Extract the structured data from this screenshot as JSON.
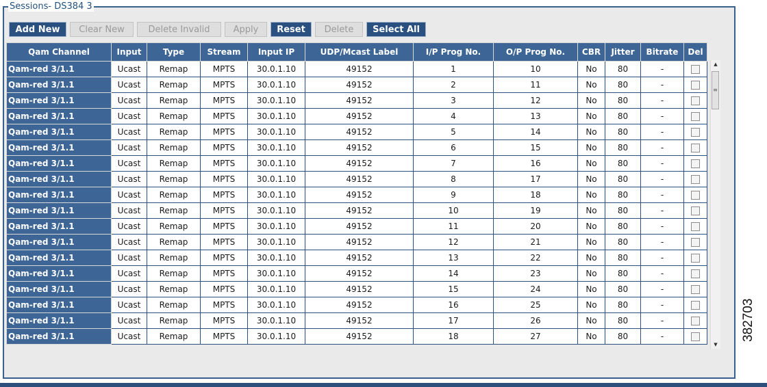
{
  "panel": {
    "title": "Sessions- DS384 3"
  },
  "toolbar": {
    "add_new": "Add New",
    "clear_new": "Clear New",
    "delete_invalid": "Delete Invalid",
    "apply": "Apply",
    "reset": "Reset",
    "delete": "Delete",
    "select_all": "Select All"
  },
  "columns": [
    "Qam Channel",
    "Input",
    "Type",
    "Stream",
    "Input IP",
    "UDP/Mcast Label",
    "I/P Prog No.",
    "O/P Prog No.",
    "CBR",
    "Jitter",
    "Bitrate",
    "Del"
  ],
  "rows": [
    [
      "Qam-red 3/1.1",
      "Ucast",
      "Remap",
      "MPTS",
      "30.0.1.10",
      "49152",
      "1",
      "10",
      "No",
      "80",
      "-"
    ],
    [
      "Qam-red 3/1.1",
      "Ucast",
      "Remap",
      "MPTS",
      "30.0.1.10",
      "49152",
      "2",
      "11",
      "No",
      "80",
      "-"
    ],
    [
      "Qam-red 3/1.1",
      "Ucast",
      "Remap",
      "MPTS",
      "30.0.1.10",
      "49152",
      "3",
      "12",
      "No",
      "80",
      "-"
    ],
    [
      "Qam-red 3/1.1",
      "Ucast",
      "Remap",
      "MPTS",
      "30.0.1.10",
      "49152",
      "4",
      "13",
      "No",
      "80",
      "-"
    ],
    [
      "Qam-red 3/1.1",
      "Ucast",
      "Remap",
      "MPTS",
      "30.0.1.10",
      "49152",
      "5",
      "14",
      "No",
      "80",
      "-"
    ],
    [
      "Qam-red 3/1.1",
      "Ucast",
      "Remap",
      "MPTS",
      "30.0.1.10",
      "49152",
      "6",
      "15",
      "No",
      "80",
      "-"
    ],
    [
      "Qam-red 3/1.1",
      "Ucast",
      "Remap",
      "MPTS",
      "30.0.1.10",
      "49152",
      "7",
      "16",
      "No",
      "80",
      "-"
    ],
    [
      "Qam-red 3/1.1",
      "Ucast",
      "Remap",
      "MPTS",
      "30.0.1.10",
      "49152",
      "8",
      "17",
      "No",
      "80",
      "-"
    ],
    [
      "Qam-red 3/1.1",
      "Ucast",
      "Remap",
      "MPTS",
      "30.0.1.10",
      "49152",
      "9",
      "18",
      "No",
      "80",
      "-"
    ],
    [
      "Qam-red 3/1.1",
      "Ucast",
      "Remap",
      "MPTS",
      "30.0.1.10",
      "49152",
      "10",
      "19",
      "No",
      "80",
      "-"
    ],
    [
      "Qam-red 3/1.1",
      "Ucast",
      "Remap",
      "MPTS",
      "30.0.1.10",
      "49152",
      "11",
      "20",
      "No",
      "80",
      "-"
    ],
    [
      "Qam-red 3/1.1",
      "Ucast",
      "Remap",
      "MPTS",
      "30.0.1.10",
      "49152",
      "12",
      "21",
      "No",
      "80",
      "-"
    ],
    [
      "Qam-red 3/1.1",
      "Ucast",
      "Remap",
      "MPTS",
      "30.0.1.10",
      "49152",
      "13",
      "22",
      "No",
      "80",
      "-"
    ],
    [
      "Qam-red 3/1.1",
      "Ucast",
      "Remap",
      "MPTS",
      "30.0.1.10",
      "49152",
      "14",
      "23",
      "No",
      "80",
      "-"
    ],
    [
      "Qam-red 3/1.1",
      "Ucast",
      "Remap",
      "MPTS",
      "30.0.1.10",
      "49152",
      "15",
      "24",
      "No",
      "80",
      "-"
    ],
    [
      "Qam-red 3/1.1",
      "Ucast",
      "Remap",
      "MPTS",
      "30.0.1.10",
      "49152",
      "16",
      "25",
      "No",
      "80",
      "-"
    ],
    [
      "Qam-red 3/1.1",
      "Ucast",
      "Remap",
      "MPTS",
      "30.0.1.10",
      "49152",
      "17",
      "26",
      "No",
      "80",
      "-"
    ],
    [
      "Qam-red 3/1.1",
      "Ucast",
      "Remap",
      "MPTS",
      "30.0.1.10",
      "49152",
      "18",
      "27",
      "No",
      "80",
      "-"
    ]
  ],
  "scrollbar": {
    "up_arrow": "▲",
    "down_arrow": "▼",
    "grip": "≡"
  },
  "figure_id": "382703",
  "colors": {
    "header": "#3d6697",
    "accent": "#29507f",
    "border": "#2c4f7c"
  }
}
